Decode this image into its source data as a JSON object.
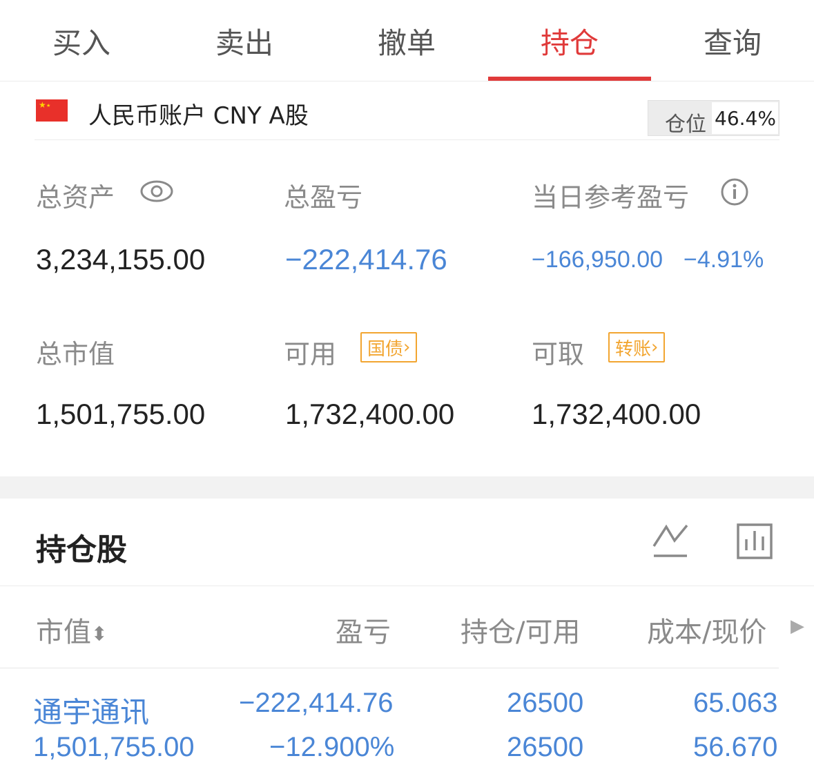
{
  "tabs": [
    {
      "label": "买入"
    },
    {
      "label": "卖出"
    },
    {
      "label": "撤单"
    },
    {
      "label": "持仓"
    },
    {
      "label": "查询"
    }
  ],
  "account": {
    "name": "人民币账户 CNY A股",
    "position_label": "仓位",
    "position_value": "46.4%"
  },
  "stats": {
    "total_assets_label": "总资产",
    "total_assets": "3,234,155.00",
    "total_pnl_label": "总盈亏",
    "total_pnl": "−222,414.76",
    "daily_pnl_label": "当日参考盈亏",
    "daily_pnl": "−166,950.00",
    "daily_pnl_pct": "−4.91%",
    "market_value_label": "总市值",
    "market_value": "1,501,755.00",
    "available_label": "可用",
    "available_badge": "国债",
    "available": "1,732,400.00",
    "withdrawable_label": "可取",
    "withdrawable_badge": "转账",
    "withdrawable": "1,732,400.00"
  },
  "holdings": {
    "title": "持仓股",
    "columns": [
      "市值",
      "盈亏",
      "持仓/可用",
      "成本/现价"
    ],
    "rows": [
      {
        "name": "通宇通讯",
        "market_value": "1,501,755.00",
        "pnl": "−222,414.76",
        "pnl_pct": "−12.900%",
        "position": "26500",
        "available": "26500",
        "cost": "65.063",
        "price": "56.670"
      }
    ]
  },
  "colors": {
    "accent": "#e03a3a",
    "loss": "#4a86d6",
    "badge": "#f2a530"
  }
}
